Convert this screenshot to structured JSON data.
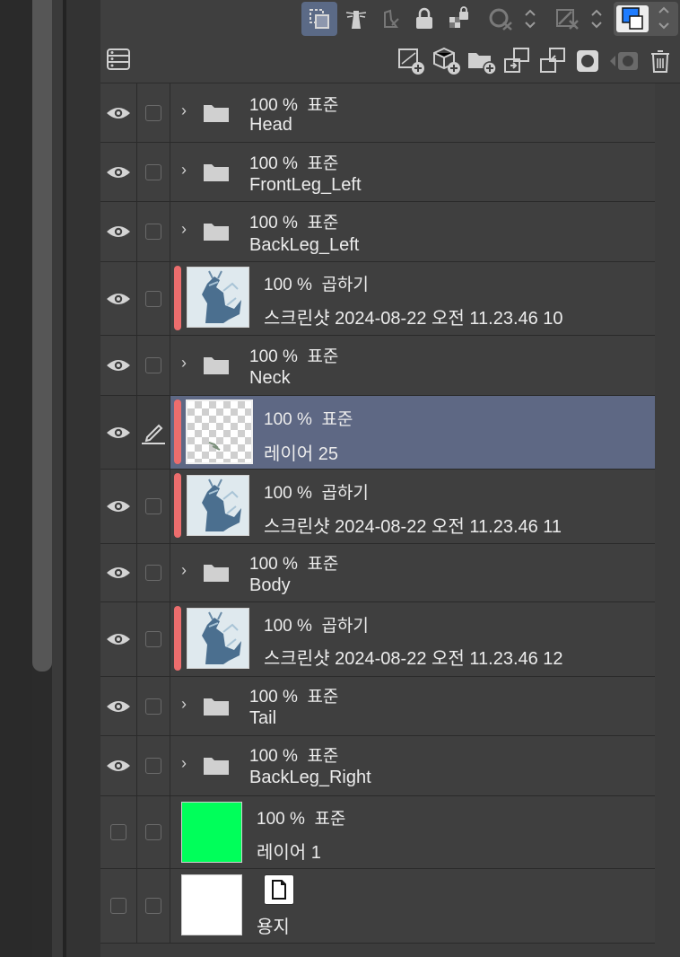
{
  "toolbar": {
    "top_icons": [
      "layer-select-icon",
      "lighthouse-icon",
      "ref-layer-icon",
      "lock-icon",
      "transparent-lock-icon",
      "mask-clip-icon",
      "draft-layer-icon",
      "color-swatch-icon"
    ],
    "bottom_icons": [
      "layer-list-icon",
      "new-raster-layer-icon",
      "new-vector-layer-icon",
      "new-folder-icon",
      "transfer-down-icon",
      "merge-down-icon",
      "mask-icon",
      "mask-apply-icon",
      "delete-layer-icon"
    ]
  },
  "layers": [
    {
      "kind": "folder",
      "visible": true,
      "opacity": "100 %",
      "blend": "표준",
      "name": "Head"
    },
    {
      "kind": "folder",
      "visible": true,
      "opacity": "100 %",
      "blend": "표준",
      "name": "FrontLeg_Left"
    },
    {
      "kind": "folder",
      "visible": true,
      "opacity": "100 %",
      "blend": "표준",
      "name": "BackLeg_Left"
    },
    {
      "kind": "image",
      "visible": true,
      "opacity": "100 %",
      "blend": "곱하기",
      "name": "스크린샷 2024-08-22 오전 11.23.46 10",
      "clip": true
    },
    {
      "kind": "folder",
      "visible": true,
      "opacity": "100 %",
      "blend": "표준",
      "name": "Neck"
    },
    {
      "kind": "raster",
      "visible": true,
      "opacity": "100 %",
      "blend": "표준",
      "name": "레이어 25",
      "clip": true,
      "selected": true
    },
    {
      "kind": "image",
      "visible": true,
      "opacity": "100 %",
      "blend": "곱하기",
      "name": "스크린샷 2024-08-22 오전 11.23.46 11",
      "clip": true
    },
    {
      "kind": "folder",
      "visible": true,
      "opacity": "100 %",
      "blend": "표준",
      "name": "Body"
    },
    {
      "kind": "image",
      "visible": true,
      "opacity": "100 %",
      "blend": "곱하기",
      "name": "스크린샷 2024-08-22 오전 11.23.46 12",
      "clip": true
    },
    {
      "kind": "folder",
      "visible": true,
      "opacity": "100 %",
      "blend": "표준",
      "name": "Tail"
    },
    {
      "kind": "folder",
      "visible": true,
      "opacity": "100 %",
      "blend": "표준",
      "name": "BackLeg_Right"
    },
    {
      "kind": "fill",
      "visible": false,
      "opacity": "100 %",
      "blend": "표준",
      "name": "레이어 1",
      "color": "#00ff5a"
    },
    {
      "kind": "paper",
      "visible": false,
      "name": "용지",
      "color": "#ffffff"
    }
  ],
  "colors": {
    "selected_row": "#5e6884",
    "clip_bar": "#ec6d6d"
  }
}
